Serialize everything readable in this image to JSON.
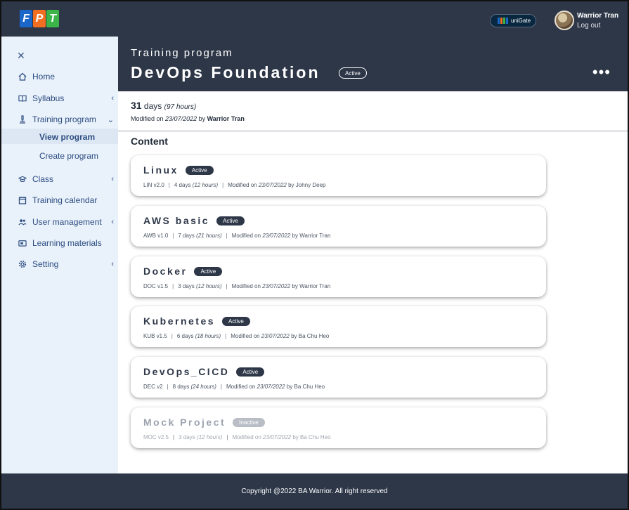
{
  "topbar": {
    "logo_letters": [
      "F",
      "P",
      "T"
    ],
    "unigate_label": "uniGate",
    "user_name": "Warrior Tran",
    "logout_label": "Log out"
  },
  "sidebar": {
    "items": [
      {
        "label": "Home",
        "icon": "home-icon"
      },
      {
        "label": "Syllabus",
        "icon": "book-icon",
        "chevron": "‹"
      },
      {
        "label": "Training program",
        "icon": "microscope-icon",
        "chevron": "⌄"
      },
      {
        "label": "Class",
        "icon": "graduation-cap-icon",
        "chevron": "‹"
      },
      {
        "label": "Training calendar",
        "icon": "calendar-icon"
      },
      {
        "label": "User management",
        "icon": "users-icon",
        "chevron": "‹"
      },
      {
        "label": "Learning materials",
        "icon": "folder-icon"
      },
      {
        "label": "Setting",
        "icon": "gear-icon",
        "chevron": "‹"
      }
    ],
    "subitems": [
      {
        "label": "View program",
        "active": true
      },
      {
        "label": "Create program",
        "active": false
      }
    ]
  },
  "header": {
    "eyebrow": "Training program",
    "title": "DevOps Foundation",
    "status": "Active"
  },
  "summary": {
    "days_number": "31",
    "days_word": "days",
    "hours": "(97 hours)",
    "modified_prefix": "Modified on",
    "modified_date": "23/07/2022",
    "by_word": "by",
    "modified_by": "Warrior Tran"
  },
  "content_title": "Content",
  "modules": [
    {
      "name": "Linux",
      "status": "Active",
      "code": "LIN v2.0",
      "days": "4 days",
      "hours": "(12 hours)",
      "modified_prefix": "Modified on",
      "date": "23/07/2022",
      "by": "by Johny Deep",
      "inactive": false
    },
    {
      "name": "AWS basic",
      "status": "Active",
      "code": "AWB v1.0",
      "days": "7 days",
      "hours": "(21 hours)",
      "modified_prefix": "Modified on",
      "date": "23/07/2022",
      "by": "by Warrior Tran",
      "inactive": false
    },
    {
      "name": "Docker",
      "status": "Active",
      "code": "DOC v1.5",
      "days": "3 days",
      "hours": "(12 hours)",
      "modified_prefix": "Modified on",
      "date": "23/07/2022",
      "by": "by Warrior Tran",
      "inactive": false
    },
    {
      "name": "Kubernetes",
      "status": "Active",
      "code": "KUB v1.5",
      "days": "6 days",
      "hours": "(18 hours)",
      "modified_prefix": "Modified on",
      "date": "23/07/2022",
      "by": "by Ba Chu Heo",
      "inactive": false
    },
    {
      "name": "DevOps_CICD",
      "status": "Active",
      "code": "DEC v2",
      "days": "8 days",
      "hours": "(24 hours)",
      "modified_prefix": "Modified on",
      "date": "23/07/2022",
      "by": "by Ba Chu Heo",
      "inactive": false
    },
    {
      "name": "Mock Project",
      "status": "Inactive",
      "code": "MOC v2.5",
      "days": "3 days",
      "hours": "(12 hours)",
      "modified_prefix": "Modified on",
      "date": "23/07/2022",
      "by": "by Ba Chu Heo",
      "inactive": true
    }
  ],
  "footer": {
    "copyright": "Copyright @2022 BA Warrior. All right reserved"
  },
  "colors": {
    "dark_navy": "#2d3748",
    "sidebar_bg": "#e9f1fb",
    "sidebar_text": "#2c4d80",
    "fpt_blue": "#1b66c9",
    "fpt_orange": "#f26f21",
    "fpt_green": "#3bb44a"
  }
}
